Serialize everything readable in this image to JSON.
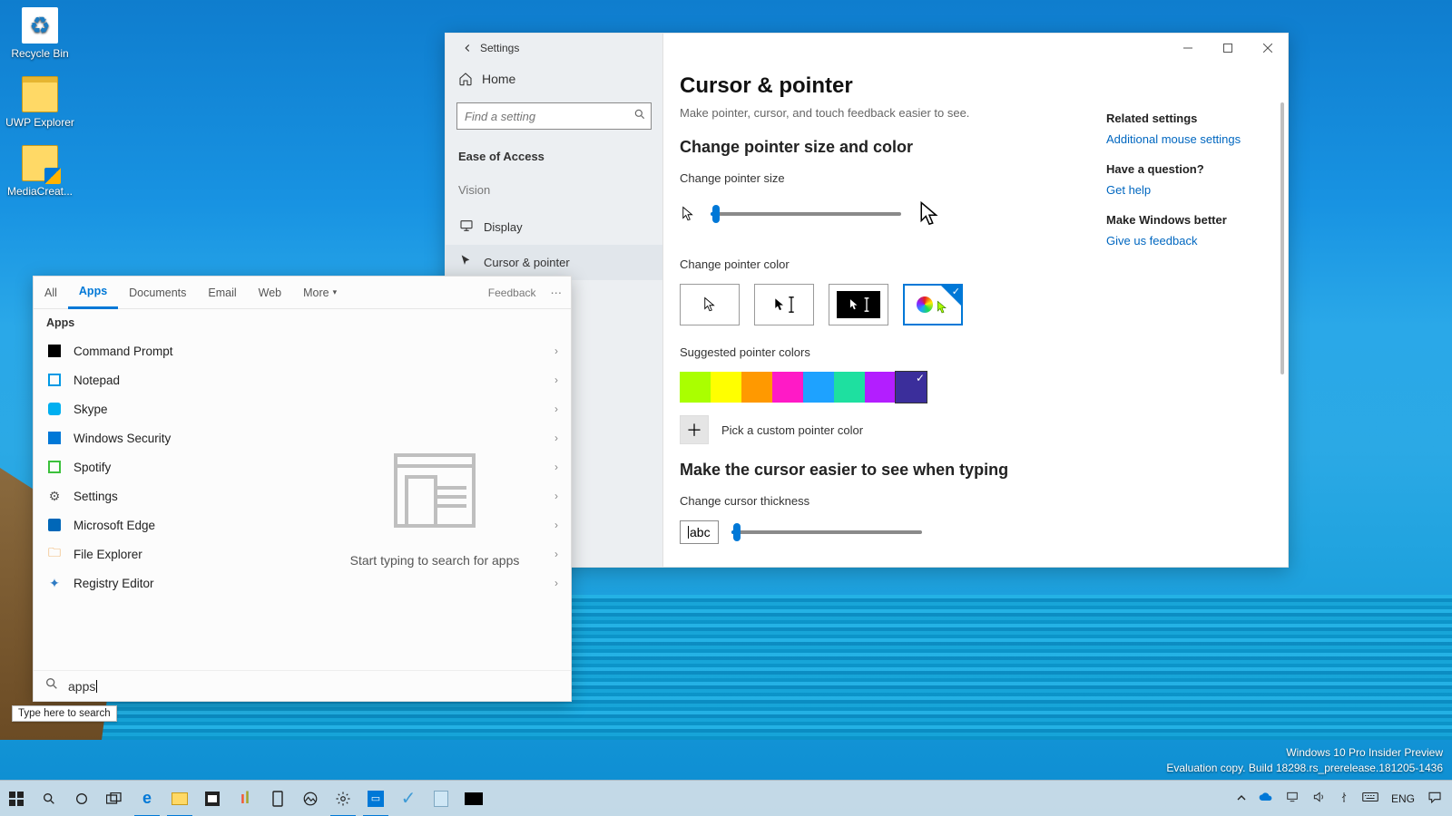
{
  "desktop": {
    "icons": [
      {
        "label": "Recycle Bin"
      },
      {
        "label": "UWP Explorer"
      },
      {
        "label": "MediaCreat..."
      }
    ]
  },
  "settings": {
    "title": "Settings",
    "home": "Home",
    "search_placeholder": "Find a setting",
    "category": "Ease of Access",
    "subcat": "Vision",
    "nav_display": "Display",
    "nav_cursor": "Cursor & pointer",
    "page_title": "Cursor & pointer",
    "page_sub": "Make pointer, cursor, and touch feedback easier to see.",
    "h_size": "Change pointer size and color",
    "lbl_size": "Change pointer size",
    "lbl_color": "Change pointer color",
    "lbl_sug": "Suggested pointer colors",
    "lbl_pick": "Pick a custom pointer color",
    "h_cursor": "Make the cursor easier to see when typing",
    "lbl_thick": "Change cursor thickness",
    "abc": "abc",
    "rail_related": "Related settings",
    "rail_link1": "Additional mouse settings",
    "rail_q": "Have a question?",
    "rail_link2": "Get help",
    "rail_better": "Make Windows better",
    "rail_link3": "Give us feedback",
    "sug_colors": [
      "#aaff00",
      "#ffff00",
      "#ff9900",
      "#ff1ac6",
      "#1ea2ff",
      "#1ee0a0",
      "#b31eff",
      "#3b2e9b"
    ],
    "selected_color_index": 7
  },
  "search": {
    "tabs": {
      "all": "All",
      "apps": "Apps",
      "documents": "Documents",
      "email": "Email",
      "web": "Web",
      "more": "More"
    },
    "feedback": "Feedback",
    "section": "Apps",
    "results": [
      {
        "label": "Command Prompt"
      },
      {
        "label": "Notepad"
      },
      {
        "label": "Skype"
      },
      {
        "label": "Windows Security"
      },
      {
        "label": "Spotify"
      },
      {
        "label": "Settings"
      },
      {
        "label": "Microsoft Edge"
      },
      {
        "label": "File Explorer"
      },
      {
        "label": "Registry Editor"
      }
    ],
    "preview_msg": "Start typing to search for apps",
    "query": "apps",
    "tooltip": "Type here to search"
  },
  "taskbar": {
    "lang": "ENG"
  },
  "watermark": {
    "line1": "Windows 10 Pro Insider Preview",
    "line2": "Evaluation copy. Build 18298.rs_prerelease.181205-1436"
  }
}
